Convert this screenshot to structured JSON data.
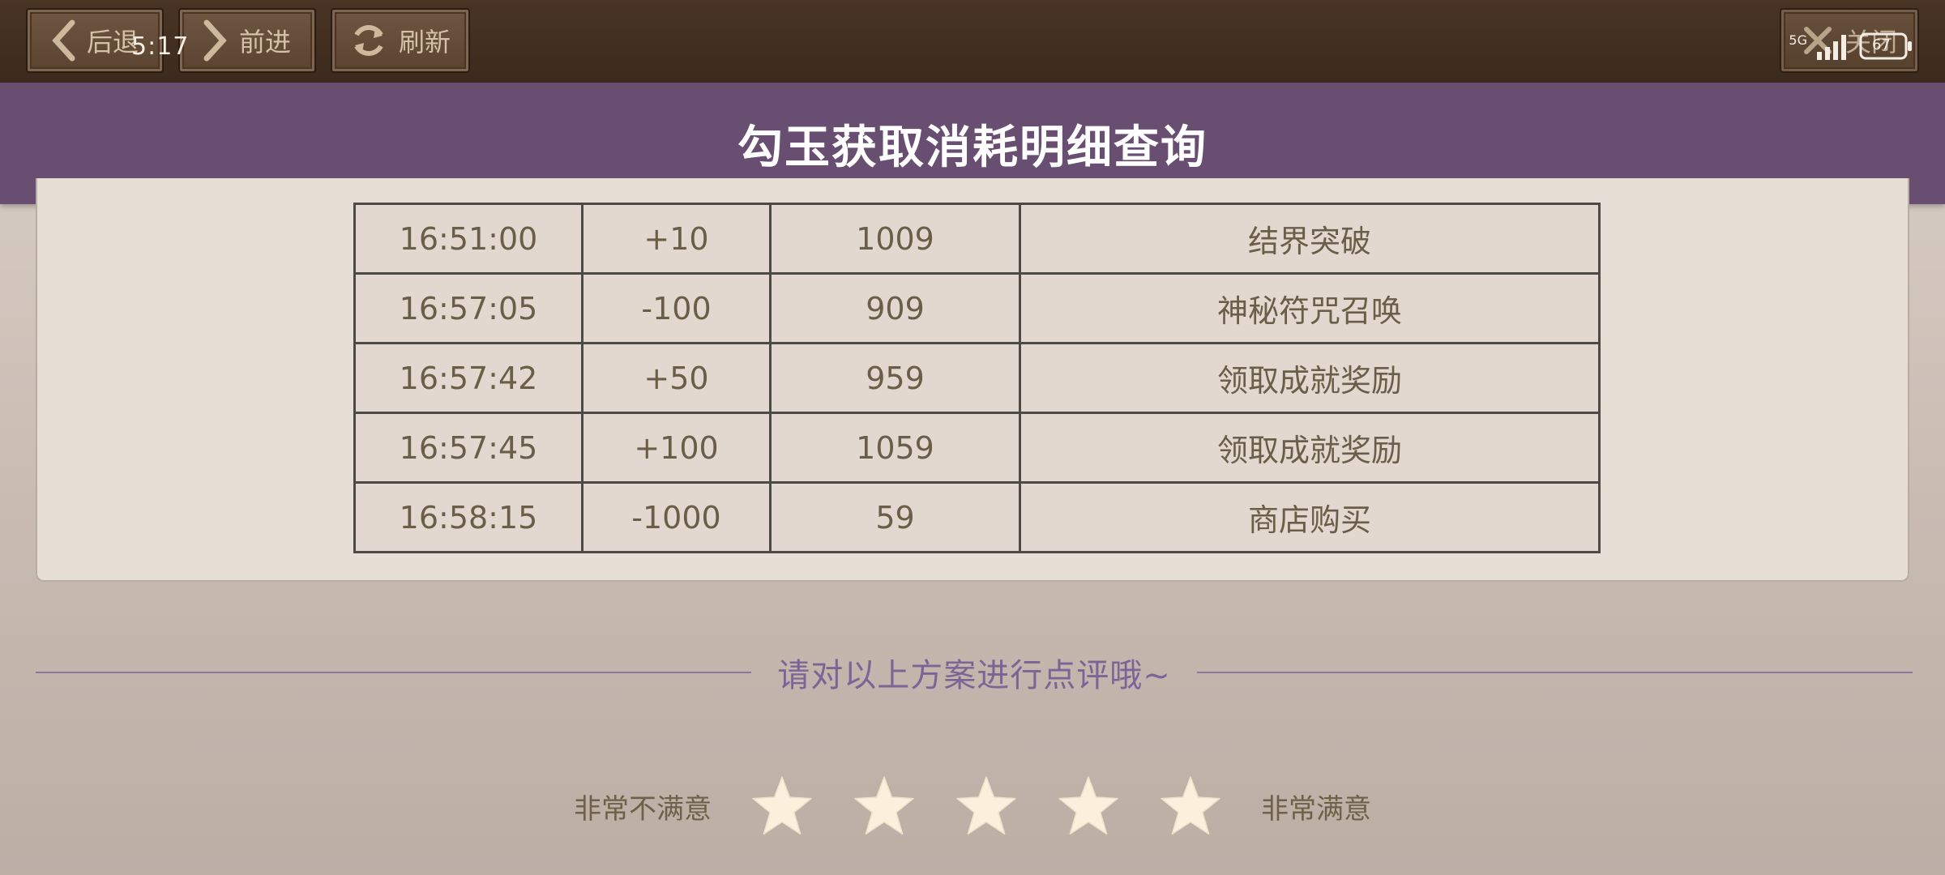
{
  "topbar": {
    "back_label": "后退",
    "forward_label": "前进",
    "refresh_label": "刷新",
    "close_label": "关闭"
  },
  "status_bar": {
    "time": "5:17",
    "network": "5G",
    "battery": "67"
  },
  "page": {
    "title": "勾玉获取消耗明细查询"
  },
  "records": [
    {
      "time": "16:51:00",
      "change": "+10",
      "balance": "1009",
      "source": "结界突破"
    },
    {
      "time": "16:57:05",
      "change": "-100",
      "balance": "909",
      "source": "神秘符咒召唤"
    },
    {
      "time": "16:57:42",
      "change": "+50",
      "balance": "959",
      "source": "领取成就奖励"
    },
    {
      "time": "16:57:45",
      "change": "+100",
      "balance": "1059",
      "source": "领取成就奖励"
    },
    {
      "time": "16:58:15",
      "change": "-1000",
      "balance": "59",
      "source": "商店购买"
    }
  ],
  "review": {
    "prompt": "请对以上方案进行点评哦~",
    "low_label": "非常不满意",
    "high_label": "非常满意",
    "max_stars": 5,
    "selected_stars": 0
  },
  "colors": {
    "topbar": "#3b2a1d",
    "banner": "#684e71",
    "accent": "#7d6496",
    "star": "#faf0dc"
  },
  "icons": [
    "chevron-left-icon",
    "chevron-right-icon",
    "refresh-icon",
    "close-icon",
    "signal-icon",
    "battery-icon",
    "star-icon"
  ]
}
